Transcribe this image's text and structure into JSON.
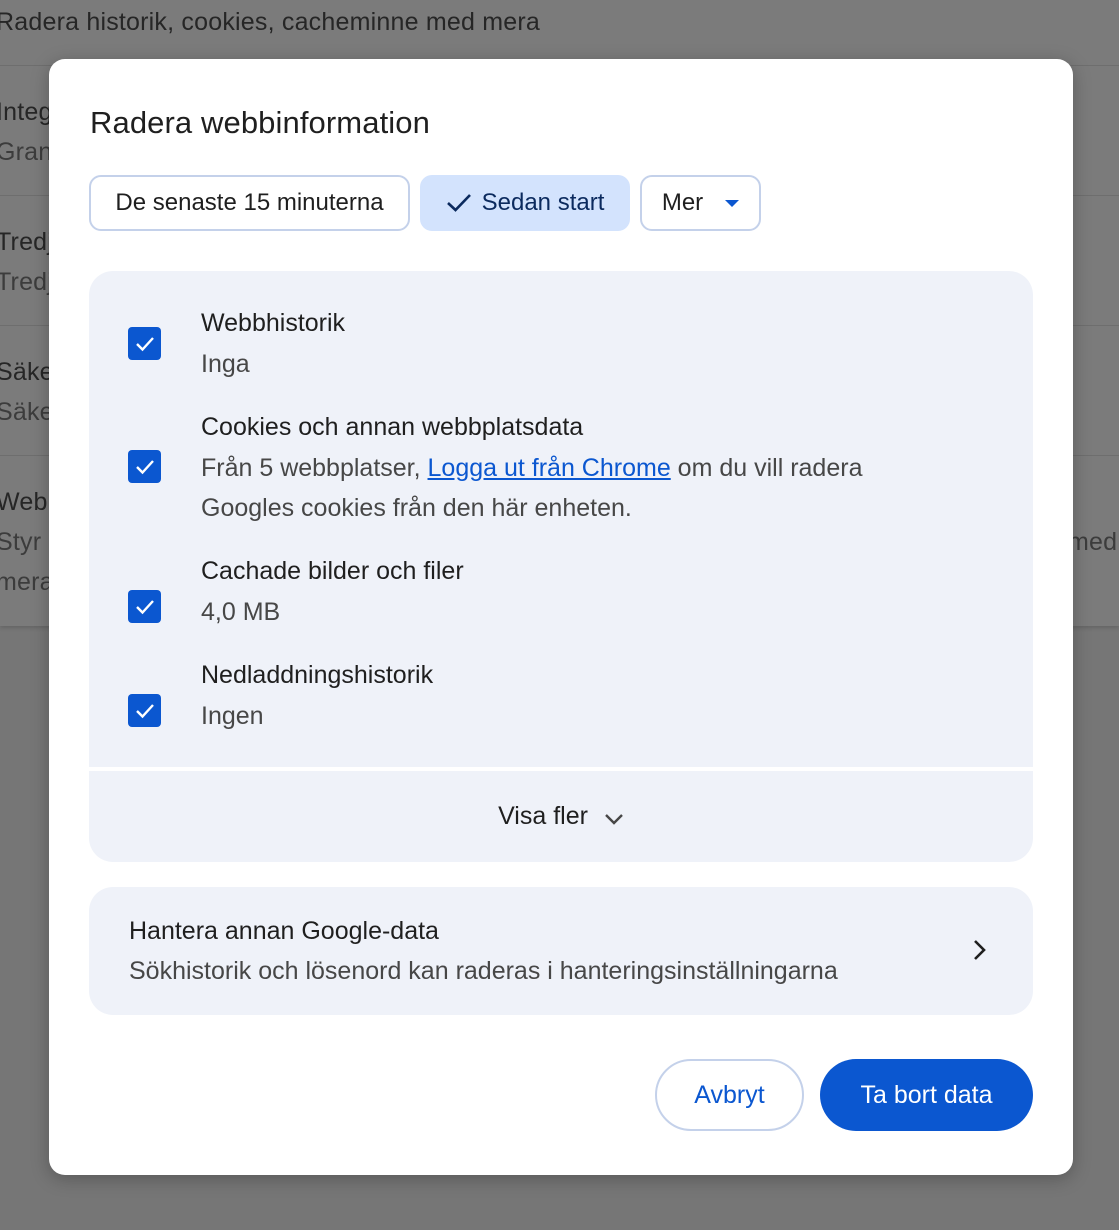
{
  "background": {
    "top_row": "Radera historik, cookies, cacheminne med mera",
    "rows": [
      {
        "title": "Integ",
        "subtitle": "Gran"
      },
      {
        "title": "Tredj",
        "subtitle": "Tredj"
      },
      {
        "title": "Säke",
        "subtitle": "Säke"
      },
      {
        "title": "Web",
        "subtitle": "Styr",
        "extra": "mera",
        "right": "med"
      }
    ]
  },
  "dialog": {
    "title": "Radera webbinformation",
    "time_chips": [
      {
        "label": "De senaste 15 minuterna",
        "selected": false
      },
      {
        "label": "Sedan start",
        "selected": true
      },
      {
        "label": "Mer",
        "selected": false,
        "dropdown": true
      }
    ],
    "options": [
      {
        "title": "Webbhistorik",
        "desc": "Inga",
        "checked": true
      },
      {
        "title": "Cookies och annan webbplatsdata",
        "desc_before": "Från 5 webbplatser, ",
        "link": "Logga ut från Chrome",
        "desc_after": " om du vill radera",
        "desc_line2": "Googles cookies från den här enheten.",
        "checked": true
      },
      {
        "title": "Cachade bilder och filer",
        "desc": "4,0 MB",
        "checked": true
      },
      {
        "title": "Nedladdningshistorik",
        "desc": "Ingen",
        "checked": true
      }
    ],
    "show_more": "Visa fler",
    "manage": {
      "title": "Hantera annan Google-data",
      "desc": "Sökhistorik och lösenord kan raderas i hanteringsinställningarna"
    },
    "buttons": {
      "cancel": "Avbryt",
      "delete": "Ta bort data"
    }
  },
  "colors": {
    "accent": "#0b57d0",
    "chip_selected": "#d3e3fd",
    "card_bg": "#eff2f9",
    "scrim": "#767676"
  }
}
